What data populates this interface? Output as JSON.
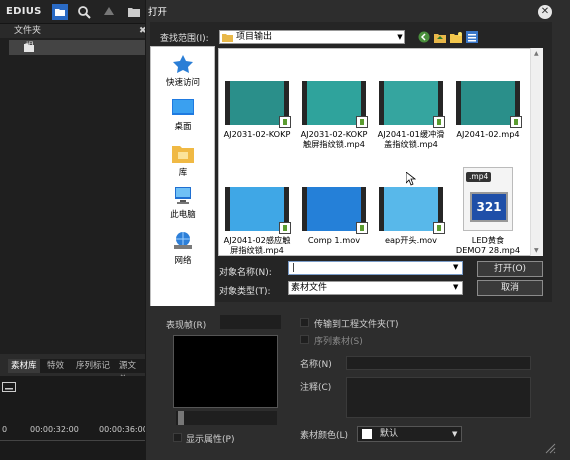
{
  "app": {
    "logo": "EDIUS"
  },
  "left": {
    "folder_header": "文件夹",
    "root_item": "根",
    "tabs": [
      "素材库",
      "特效",
      "序列标记",
      "源文件"
    ],
    "timecodes": [
      "0",
      "00:00:32:00",
      "00:00:36:00"
    ]
  },
  "dialog": {
    "title": "打开",
    "lookin_label": "查找范围(I):",
    "lookin_value": "项目输出",
    "places": [
      {
        "label": "快速访问",
        "icon": "star-icon"
      },
      {
        "label": "桌面",
        "icon": "desktop-icon"
      },
      {
        "label": "库",
        "icon": "library-icon"
      },
      {
        "label": "此电脑",
        "icon": "computer-icon"
      },
      {
        "label": "网络",
        "icon": "network-icon"
      }
    ],
    "files": [
      {
        "name": "AJ2031-02-KOKP",
        "line2": ""
      },
      {
        "name": "AJ2031-02-KOKP",
        "line2": "触屏指纹锁.mp4"
      },
      {
        "name": "AJ2041-01缓冲滑",
        "line2": "盖指纹锁.mp4"
      },
      {
        "name": "AJ2041-02.mp4",
        "line2": ""
      },
      {
        "name": "AJ2041-02感应触",
        "line2": "屏指纹锁.mp4"
      },
      {
        "name": "Comp 1.mov",
        "line2": ""
      },
      {
        "name": "eap开头.mov",
        "line2": ""
      },
      {
        "name": "LED黄食",
        "line2": "DEMO7 28.mp4"
      }
    ],
    "mp4_badge": ".mp4",
    "mp4_logo": "321",
    "name_label": "对象名称(N):",
    "name_value": "",
    "type_label": "对象类型(T):",
    "type_value": "素材文件",
    "open_label": "打开(O)",
    "cancel_label": "取消",
    "preview_label": "表现帧(R)",
    "show_props_label": "显示属性(P)",
    "copy_to_project_label": "传输到工程文件夹(T)",
    "seq_clip_label": "序列素材(S)",
    "name_field_label": "名称(N)",
    "comment_label": "注释(C)",
    "color_label": "素材颜色(L)",
    "color_value": "默认"
  }
}
